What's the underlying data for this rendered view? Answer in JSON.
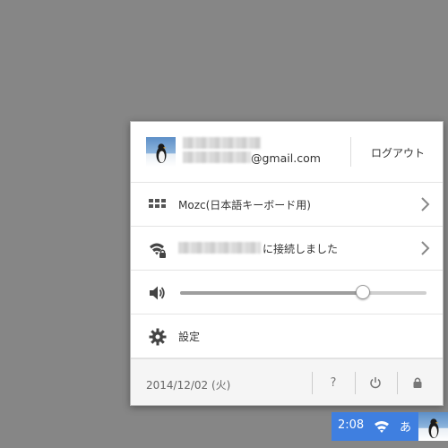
{
  "user": {
    "email_domain": "@gmail.com",
    "logout_label": "ログアウト",
    "avatar_icon": "penguin-avatar-icon"
  },
  "ime": {
    "label": "Mozc(日本語キーボード用)",
    "icon": "keyboard-icon"
  },
  "network": {
    "label": "に接続しました",
    "icon": "wifi-lock-icon"
  },
  "volume": {
    "level": 0.74,
    "icon": "speaker-icon"
  },
  "settings": {
    "label": "設定",
    "icon": "gear-icon"
  },
  "footer": {
    "date": "2014/12/02 (火)",
    "help_label": "?",
    "power_icon": "power-icon",
    "lock_icon": "lock-icon"
  },
  "shelf": {
    "clock": "2:08",
    "ime_indicator": "あ",
    "background": "#3f7fe0"
  }
}
